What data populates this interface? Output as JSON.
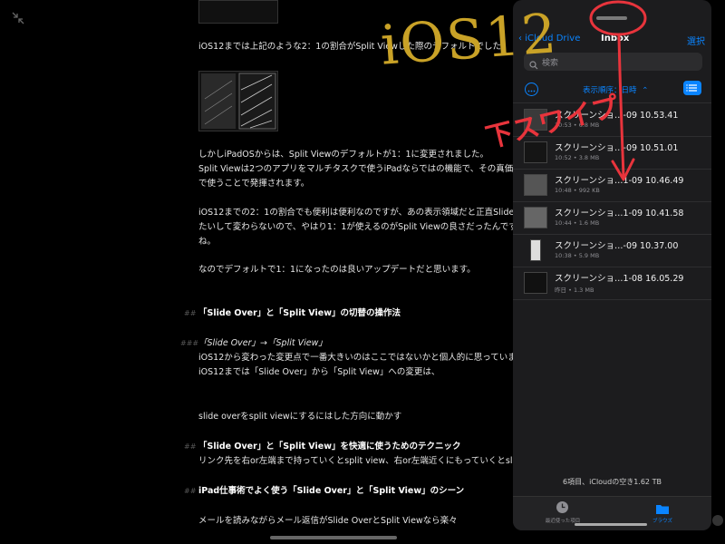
{
  "document": {
    "line_ratio_default": "iOS12までは上記のような2：1の割合がSplit Viewした際のデフォルトでした。",
    "p1_a": "しかしiPadOSからは、Split Viewのデフォルトが1：1に変更されました。",
    "p1_b": "Split Viewは2つのアプリをマルチタスクで使うiPadならではの機能で、その真価は1",
    "p1_c": "で使うことで発揮されます。",
    "p2_a": "iOS12までの2：1の割合でも便利は便利なのですが、あの表示領域だと正直Slide Over",
    "p2_b": "たいして変わらないので、やはり1：1が使えるのがSplit Viewの良さだったんですよ",
    "p2_c": "ね。",
    "p3": "なのでデフォルトで1：1になったのは良いアップデートだと思います。",
    "h2_switch_mark": "##",
    "h2_switch": "「Slide Over」と「Split View」の切替の操作法",
    "h3_mark": "###",
    "h3": "「Slide Over」→「Split View」",
    "p4_a": "iOS12から変わった変更点で一番大きいのはここではないかと個人的に思っています。",
    "p4_b": "iOS12までは「Slide Over」から「Split View」への変更は、",
    "p5": "slide overをsplit viewにするにはした方向に動かす",
    "h2_tips_mark": "##",
    "h2_tips": "「Slide Over」と「Split View」を快適に使うためのテクニック",
    "p6": "リンク先を右or左端まで持っていくとsplit view、右or左端近くにもっていくとslide o",
    "h2_scene_mark": "##",
    "h2_scene": "iPad仕事術でよく使う「Slide Over」と「Split View」のシーン",
    "p7": "メールを読みながらメール返信がSlide OverとSplit Viewなら楽々"
  },
  "files_panel": {
    "back_label": "iCloud Drive",
    "title": "Inbox",
    "select_label": "選択",
    "search_placeholder": "検索",
    "sort_label": "表示順序：日時",
    "summary": "6項目、iCloudの空き1.62 TB",
    "files": [
      {
        "name": "スクリーンショ…-09 10.53.41",
        "meta": "10:53 • 6.8 MB"
      },
      {
        "name": "スクリーンショ…-09 10.51.01",
        "meta": "10:52 • 3.8 MB"
      },
      {
        "name": "スクリーンショ…1-09 10.46.49",
        "meta": "10:48 • 992 KB"
      },
      {
        "name": "スクリーンショ…1-09 10.41.58",
        "meta": "10:44 • 1.6 MB"
      },
      {
        "name": "スクリーンショ…-09 10.37.00",
        "meta": "10:38 • 5.9 MB"
      },
      {
        "name": "スクリーンショ…1-08 16.05.29",
        "meta": "昨日 • 1.3 MB"
      }
    ],
    "tab_recent": "最近使った項目",
    "tab_browse": "ブラウズ"
  },
  "annotations": {
    "ios12": "iOS12",
    "swipe_down": "下スワイプ"
  },
  "colors": {
    "accent": "#0a84ff",
    "annotation_yellow": "#c9a227",
    "annotation_red": "#e8343c"
  }
}
